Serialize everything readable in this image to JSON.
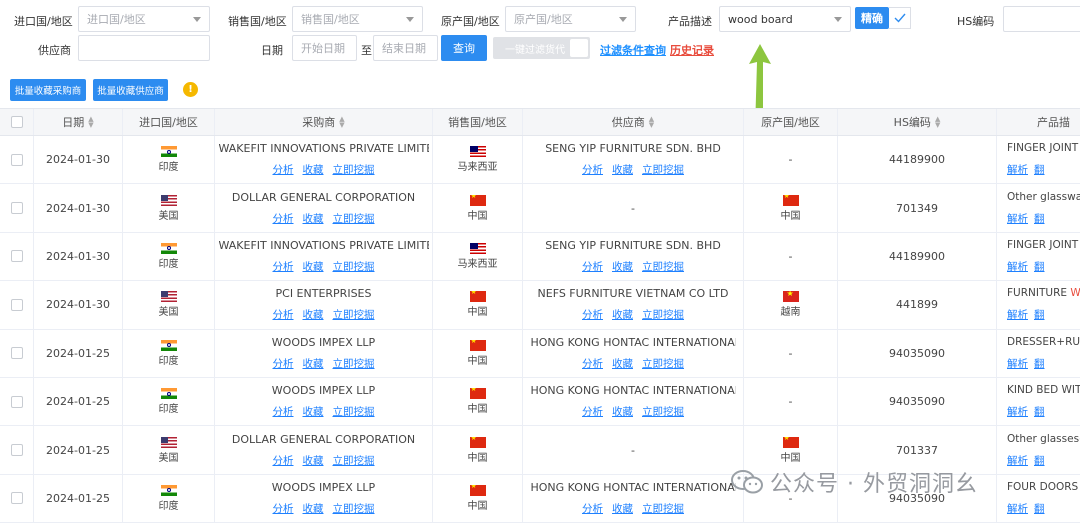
{
  "filters": {
    "import_country_label": "进口国/地区",
    "import_country_placeholder": "进口国/地区",
    "sales_country_label": "销售国/地区",
    "sales_country_placeholder": "销售国/地区",
    "origin_country_label": "原产国/地区",
    "origin_country_placeholder": "原产国/地区",
    "product_desc_label": "产品描述",
    "product_desc_value": "wood board",
    "exact_label": "精确",
    "hs_label": "HS编码",
    "supplier_label": "供应商",
    "date_label": "日期",
    "start_date_placeholder": "开始日期",
    "date_sep": "至",
    "end_date_placeholder": "结束日期",
    "query_button": "查询",
    "one_click_filter": "一键过滤货代",
    "filter_query_link": "过滤条件查询",
    "history_link": "历史记录"
  },
  "toolbar": {
    "batch_buyer": "批量收藏采购商",
    "batch_supplier": "批量收藏供应商",
    "warn_icon": "!"
  },
  "table": {
    "headers": [
      "日期",
      "进口国/地区",
      "采购商",
      "销售国/地区",
      "供应商",
      "原产国/地区",
      "HS编码",
      "产品描"
    ],
    "actions": [
      "分析",
      "收藏",
      "立即挖掘"
    ],
    "desc_actions": [
      "解析",
      "翻"
    ],
    "rows": [
      {
        "date": "2024-01-30",
        "import_flag": "in",
        "import": "印度",
        "buyer": "WAKEFIT INNOVATIONS PRIVATE LIMITED",
        "sales_flag": "my",
        "sales": "马来西亚",
        "supplier": "SENG YIP FURNITURE SDN. BHD",
        "origin_flag": "",
        "origin": "-",
        "hs": "44189900",
        "desc": "FINGER JOINT",
        "desc_red": ""
      },
      {
        "date": "2024-01-30",
        "import_flag": "us",
        "import": "美国",
        "buyer": "DOLLAR GENERAL CORPORATION",
        "sales_flag": "cn",
        "sales": "中国",
        "supplier": "-",
        "origin_flag": "cn",
        "origin": "中国",
        "hs": "701349",
        "desc": "Other glassware",
        "desc_red": ""
      },
      {
        "date": "2024-01-30",
        "import_flag": "in",
        "import": "印度",
        "buyer": "WAKEFIT INNOVATIONS PRIVATE LIMITED",
        "sales_flag": "my",
        "sales": "马来西亚",
        "supplier": "SENG YIP FURNITURE SDN. BHD",
        "origin_flag": "",
        "origin": "-",
        "hs": "44189900",
        "desc": "FINGER JOINT",
        "desc_red": ""
      },
      {
        "date": "2024-01-30",
        "import_flag": "us",
        "import": "美国",
        "buyer": "PCI ENTERPRISES",
        "sales_flag": "cn",
        "sales": "中国",
        "supplier": "NEFS FURNITURE VIETNAM CO LTD",
        "origin_flag": "vn",
        "origin": "越南",
        "hs": "441899",
        "desc": "FURNITURE ",
        "desc_red": "W"
      },
      {
        "date": "2024-01-25",
        "import_flag": "in",
        "import": "印度",
        "buyer": "WOODS IMPEX LLP",
        "sales_flag": "cn",
        "sales": "中国",
        "supplier": "HONG KONG HONTAC INTERNATIONAL CO",
        "origin_flag": "",
        "origin": "-",
        "hs": "94035090",
        "desc": "DRESSER+RUB",
        "desc_red": ""
      },
      {
        "date": "2024-01-25",
        "import_flag": "in",
        "import": "印度",
        "buyer": "WOODS IMPEX LLP",
        "sales_flag": "cn",
        "sales": "中国",
        "supplier": "HONG KONG HONTAC INTERNATIONAL CO",
        "origin_flag": "",
        "origin": "-",
        "hs": "94035090",
        "desc": "KIND BED WITH",
        "desc_red": ""
      },
      {
        "date": "2024-01-25",
        "import_flag": "us",
        "import": "美国",
        "buyer": "DOLLAR GENERAL CORPORATION",
        "sales_flag": "cn",
        "sales": "中国",
        "supplier": "-",
        "origin_flag": "cn",
        "origin": "中国",
        "hs": "701337",
        "desc": "Other glasses(o",
        "desc_red": ""
      },
      {
        "date": "2024-01-25",
        "import_flag": "in",
        "import": "印度",
        "buyer": "WOODS IMPEX LLP",
        "sales_flag": "cn",
        "sales": "中国",
        "supplier": "HONG KONG HONTAC INTERNATIONAL CO",
        "origin_flag": "",
        "origin": "-",
        "hs": "94035090",
        "desc": "FOUR DOORS",
        "desc_red": ""
      }
    ]
  },
  "watermark": "公众号 · 外贸洞洞幺",
  "colors": {
    "primary": "#2d8cf0",
    "link": "#1e80ff",
    "red": "#e84c3d",
    "arrow": "#8dc63f"
  }
}
